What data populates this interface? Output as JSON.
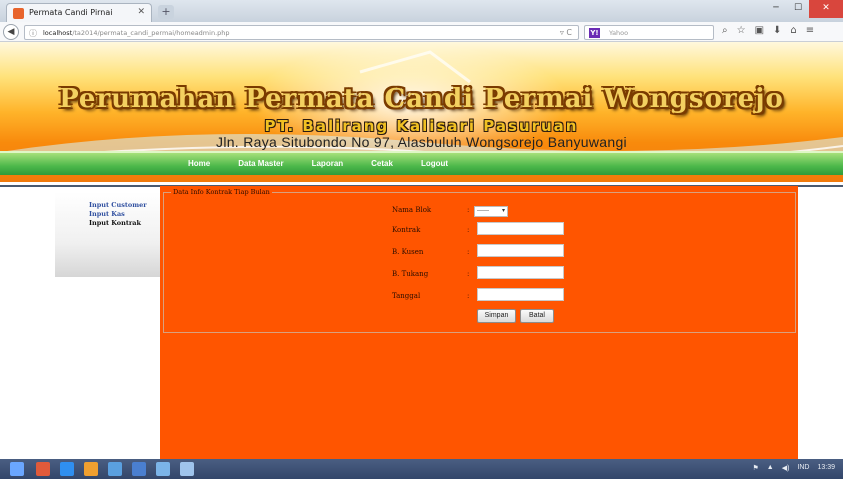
{
  "browser": {
    "tab_title": "Permata Candi Pirnai",
    "new_tab_label": "+",
    "url_host": "localhost",
    "url_path": "/ta2014/permata_candi_permai/homeadmin.php",
    "search_placeholder": "Yahoo",
    "search_engine_icon": "Y!",
    "toolbar_icons": [
      "search-icon",
      "star-icon",
      "clipboard-icon",
      "download-icon",
      "home-icon",
      "menu-icon"
    ]
  },
  "banner": {
    "title": "Perumahan Permata Candi Permai Wongsorejo",
    "company": "PT. Balirang Kalisari Pasuruan",
    "address": "Jln. Raya Situbondo No 97, Alasbuluh Wongsorejo Banyuwangi"
  },
  "menu": {
    "items": [
      {
        "label": "Home"
      },
      {
        "label": "Data Master"
      },
      {
        "label": "Laporan"
      },
      {
        "label": "Cetak"
      },
      {
        "label": "Logout"
      }
    ]
  },
  "sidebar": {
    "links": [
      {
        "label": "Input Customer",
        "active": false
      },
      {
        "label": "Input Kas",
        "active": false
      },
      {
        "label": "Input Kontrak",
        "active": true
      }
    ]
  },
  "form": {
    "legend": "Data Info Kontrak Tiap Bulan",
    "fields": [
      {
        "label": "Nama Blok",
        "colon": ":",
        "value": "------"
      },
      {
        "label": "Kontrak",
        "colon": ":",
        "value": ""
      },
      {
        "label": "B. Kusen",
        "colon": ":",
        "value": ""
      },
      {
        "label": "B. Tukang",
        "colon": ":",
        "value": ""
      },
      {
        "label": "Tanggal",
        "colon": ":",
        "value": ""
      }
    ],
    "save_label": "Simpan",
    "cancel_label": "Batal"
  },
  "taskbar": {
    "tray_text": [
      "IND",
      "13:39"
    ]
  },
  "colors": {
    "content_bg": "#ff5500",
    "menubar_green": "#4cb84a",
    "banner_orange": "#f88a0c"
  }
}
